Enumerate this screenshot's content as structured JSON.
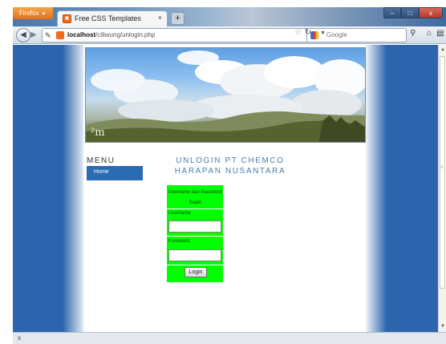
{
  "browser": {
    "menu_button": "Firefox",
    "tab_title": "Free CSS Templates",
    "tab_close": "×",
    "new_tab": "+",
    "window_buttons": [
      "–",
      "□",
      "x"
    ],
    "url_host": "localhost",
    "url_path": "/ciliwung/unlogin.php",
    "search_engine": "Google",
    "search_placeholder": "Google",
    "status_close": "x"
  },
  "page": {
    "banner_logo": "²m",
    "menu_title": "MENU",
    "menu_items": [
      {
        "label": "Home"
      }
    ],
    "heading": "UNLOGIN PT CHEMCO HARAPAN NUSANTARA",
    "login": {
      "message": "Username dan Password Salah",
      "username_label": "Username",
      "username_value": "",
      "password_label": "Password",
      "password_value": "",
      "submit_label": "Login"
    }
  },
  "colors": {
    "background_blue": "#2c65ad",
    "menu_item_blue": "#2a6cb2",
    "heading_blue": "#4a7fae",
    "form_green": "#00ff00",
    "firefox_orange": "#e2711a"
  },
  "icons": [
    "firefox-icon",
    "page-favicon",
    "back-arrow-icon",
    "forward-arrow-icon",
    "identity-icon",
    "bookmark-star-icon",
    "reload-icon",
    "google-icon",
    "search-icon",
    "home-icon",
    "addon-icon"
  ]
}
